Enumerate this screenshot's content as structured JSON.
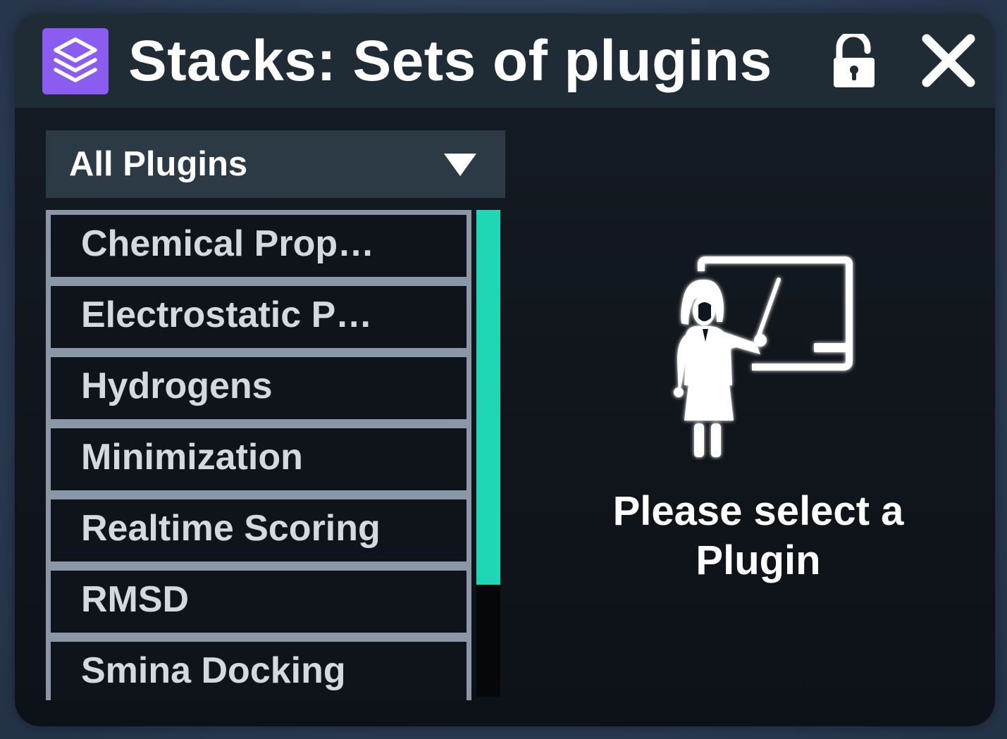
{
  "window": {
    "title": "Stacks: Sets of plugins",
    "icon": "stack-layers-icon",
    "lock_icon": "unlocked-padlock-icon",
    "close_icon": "close-x-icon"
  },
  "filter": {
    "selected": "All Plugins",
    "arrow_icon": "triangle-down-icon"
  },
  "plugins": [
    {
      "label": "Chemical Prop…"
    },
    {
      "label": "Electrostatic P…"
    },
    {
      "label": "Hydrogens"
    },
    {
      "label": "Minimization"
    },
    {
      "label": "Realtime Scoring"
    },
    {
      "label": "RMSD"
    },
    {
      "label": "Smina Docking"
    }
  ],
  "scrollbar": {
    "thumb_fraction": 0.77,
    "thumb_color": "#1fd6b5"
  },
  "placeholder": {
    "icon": "teacher-whiteboard-icon",
    "message": "Please select a Plugin"
  },
  "colors": {
    "accent": "#1fd6b5",
    "app_icon": "#8a5cf0",
    "titlebar": "#1f2b35",
    "panel": "#10151c"
  }
}
